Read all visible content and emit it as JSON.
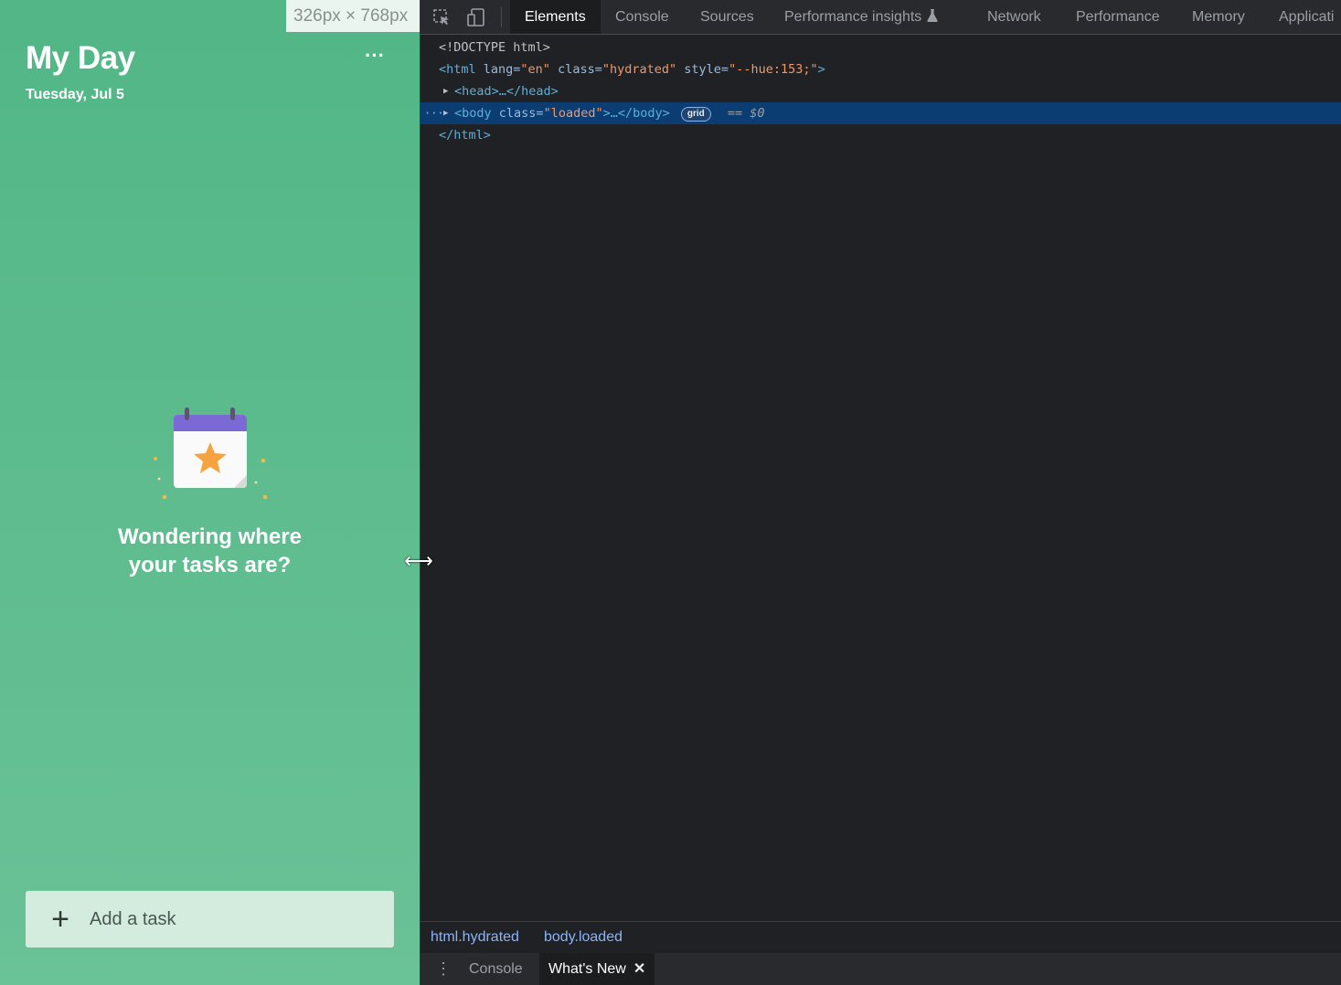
{
  "app": {
    "dimensions_label": "326px × 768px",
    "title": "My Day",
    "date": "Tuesday, Jul 5",
    "more_label": "···",
    "empty_state_line1": "Wondering where",
    "empty_state_line2": "your tasks are?",
    "add_task_plus": "+",
    "add_task_label": "Add a task",
    "resize_cursor": "⟷",
    "colors": {
      "background": "#5ebc8e",
      "add_task_bg": "#d3ecde"
    }
  },
  "devtools": {
    "tabs": [
      {
        "label": "Elements",
        "active": true
      },
      {
        "label": "Console"
      },
      {
        "label": "Sources"
      },
      {
        "label": "Performance insights",
        "icon": "flask-icon"
      },
      {
        "label": "Network"
      },
      {
        "label": "Performance"
      },
      {
        "label": "Memory"
      },
      {
        "label": "Applicati"
      }
    ],
    "toolbar_icons": [
      "inspect-element-icon",
      "device-toggle-icon"
    ],
    "dom": {
      "doctype": "<!DOCTYPE html>",
      "html_open_tag": "<html",
      "html_attr_lang": "lang=",
      "html_lang_val": "\"en\"",
      "html_attr_class": "class=",
      "html_class_val": "\"hydrated\"",
      "html_attr_style": "style=",
      "html_style_val": "\"--hue:153;\"",
      "html_close_bracket": ">",
      "head_line": "<head>…</head>",
      "body_open": "<body",
      "body_attr_class": "class=",
      "body_class_val": "\"loaded\"",
      "body_rest": ">…</body>",
      "grid_badge": "grid",
      "dollar_ref": "== $0",
      "html_close": "</html>",
      "selected_dots": "···"
    },
    "breadcrumbs": [
      "html.hydrated",
      "body.loaded"
    ],
    "drawer": {
      "menu_label": "⋮",
      "tabs": [
        {
          "label": "Console"
        },
        {
          "label": "What's New",
          "active": true,
          "close": "✕"
        }
      ]
    },
    "colors": {
      "background": "#202124",
      "selected_row": "#0b3d73",
      "tag": "#5db0d7",
      "value": "#f29766"
    }
  }
}
